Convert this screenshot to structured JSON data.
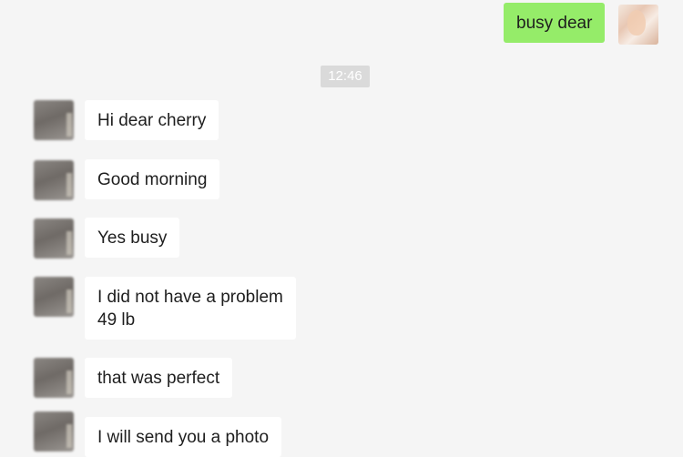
{
  "timestamp": "12:46",
  "outgoing": [
    {
      "text": "busy dear"
    }
  ],
  "incoming": [
    {
      "text": "Hi dear cherry"
    },
    {
      "text": "Good morning"
    },
    {
      "text": "Yes busy"
    },
    {
      "text": "I did not have a problem\n49 lb"
    },
    {
      "text": "that was perfect"
    },
    {
      "text": "I will send you a photo"
    }
  ]
}
